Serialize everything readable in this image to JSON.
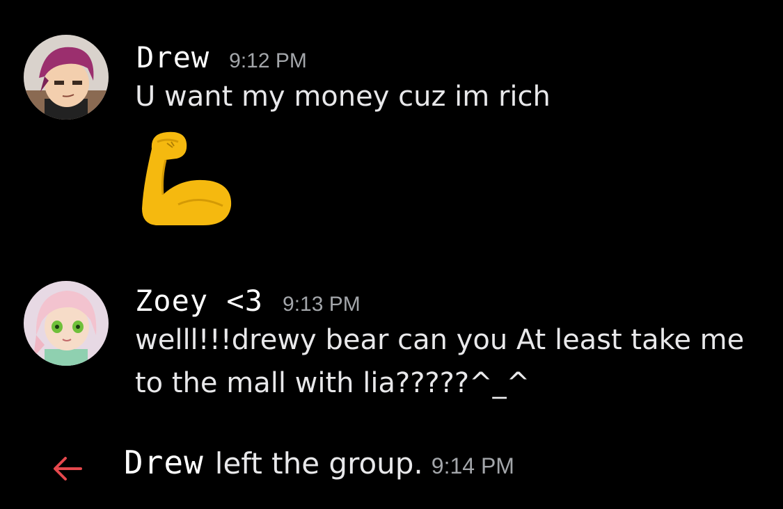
{
  "messages": [
    {
      "author": "Drew",
      "timestamp": "9:12 PM",
      "text_lines": [
        "U want my money cuz im rich"
      ],
      "attachment_icon": "flexed-biceps-emoji",
      "avatar_icon": "purple-hair-character-avatar"
    },
    {
      "author": "Zoey <3",
      "timestamp": "9:13 PM",
      "text_lines": [
        "welll!!!drewy bear can you At least take me",
        "to the mall with lia?????^_^"
      ],
      "avatar_icon": "pink-hair-character-avatar"
    }
  ],
  "system_event": {
    "icon": "left-arrow-icon",
    "author": "Drew",
    "action": "left the group.",
    "timestamp": "9:14 PM",
    "icon_color": "#e5484d"
  },
  "colors": {
    "background": "#000000",
    "timestamp": "#a3a6aa",
    "text": "#e8e8ea"
  }
}
